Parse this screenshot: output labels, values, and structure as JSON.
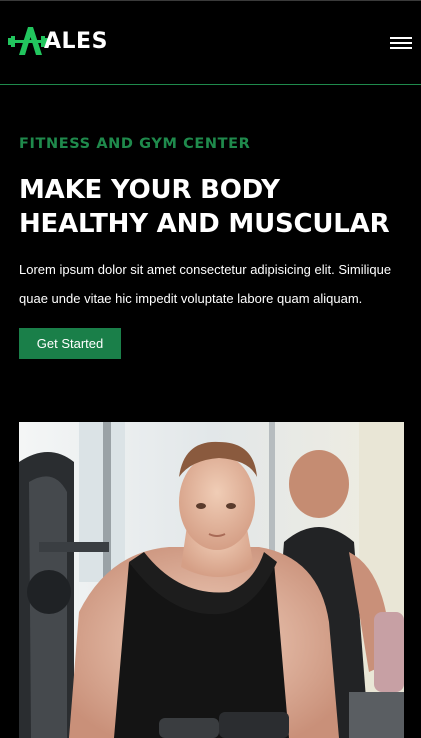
{
  "brand": {
    "name": "ALES",
    "accent": "#1f8a4c",
    "logo_icon": "dumbbell-a-icon"
  },
  "nav": {
    "menu_icon": "hamburger-menu-icon"
  },
  "hero": {
    "eyebrow": "FITNESS AND GYM CENTER",
    "headline_line1": "MAKE YOUR BODY",
    "headline_line2": "HEALTHY AND MUSCULAR",
    "lead": "Lorem ipsum dolor sit amet consectetur adipisicing elit. Similique quae unde vitae hic impedit voluptate labore quam aliquam.",
    "cta_label": "Get Started",
    "cta_color": "#1a7f49"
  },
  "media": {
    "hero_image": "muscular-man-in-gym-photo"
  }
}
